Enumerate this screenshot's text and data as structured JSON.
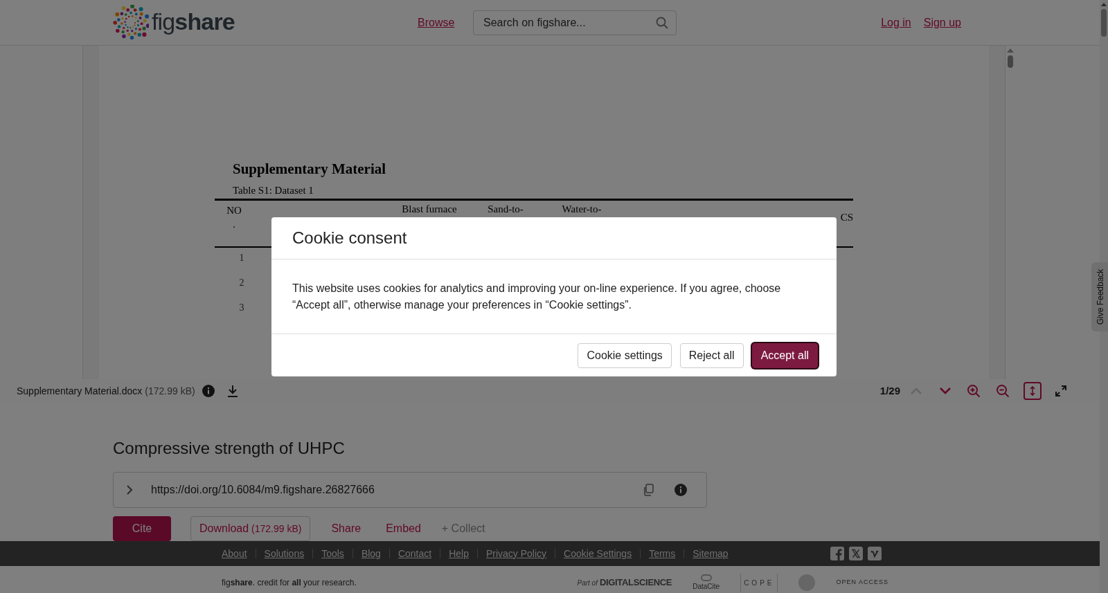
{
  "header": {
    "logo_text": "fig**share**",
    "nav_link": "Browse",
    "search": {
      "placeholder": "Search on figshare..."
    },
    "auth_links": [
      "Log in",
      "Sign up"
    ]
  },
  "document": {
    "heading": "Supplementary Material",
    "caption": "Table S1: Dataset 1",
    "columns": [
      {
        "lines": [
          "NO",
          "."
        ]
      },
      {
        "lines": [
          "Blast furnace"
        ]
      },
      {
        "lines": [
          "Sand-to-"
        ]
      },
      {
        "lines": [
          "Water-to-"
        ]
      },
      {
        "lines": [
          "CS"
        ]
      }
    ],
    "row_numbers": [
      "1",
      "2",
      "3"
    ]
  },
  "viewer_toolbar": {
    "file_name": "Supplementary Material.docx",
    "file_size": "(172.99 kB)",
    "page": "1/29",
    "previous_disabled": true,
    "next_disabled": false,
    "fit_height_selected": true
  },
  "item": {
    "title": "Compressive strength of UHPC",
    "doi": "https://doi.org/10.6084/m9.figshare.26827666",
    "actions": [
      {
        "kind": "primary",
        "label": "Cite"
      },
      {
        "kind": "outline",
        "label": "Download",
        "size": "(172.99 kB)"
      },
      {
        "kind": "link",
        "label": "Share"
      },
      {
        "kind": "link",
        "label": "Embed"
      },
      {
        "kind": "muted",
        "label": "+ Collect"
      }
    ]
  },
  "feedback_tab": "Give Feedback",
  "footer": {
    "links": [
      "About",
      "Solutions",
      "Tools",
      "Blog",
      "Contact",
      "Help",
      "Privacy Policy",
      "Cookie Settings",
      "Terms",
      "Sitemap"
    ],
    "tagline": "fig**share**. credit for **all** your research.",
    "partners": [
      {
        "kind": "digital-science",
        "prefix": "Part of",
        "name": "DIGITALSCIENCE"
      },
      {
        "kind": "datacite",
        "name": "DataCite"
      },
      {
        "kind": "cope",
        "name": "COPE"
      },
      {
        "kind": "seal"
      },
      {
        "kind": "open-access",
        "name": "OPEN ACCESS"
      }
    ]
  },
  "cookie_dialog": {
    "title": "Cookie consent",
    "message": "This website uses cookies for analytics and improving your on-line experience. If you agree, choose “Accept all”, otherwise manage your preferences in “Cookie settings”.",
    "buttons": [
      {
        "kind": "secondary",
        "label": "Cookie settings",
        "focused": false
      },
      {
        "kind": "secondary",
        "label": "Reject all",
        "focused": false
      },
      {
        "kind": "primary",
        "label": "Accept all",
        "focused": true
      }
    ]
  }
}
